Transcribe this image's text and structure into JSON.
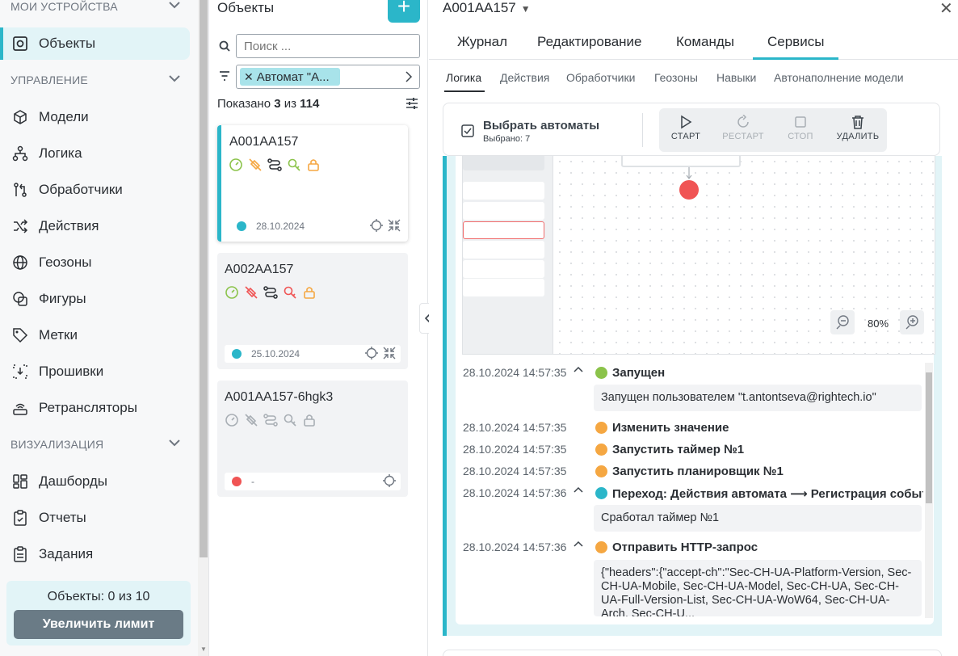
{
  "sidebar": {
    "sections": {
      "devices": "МОИ УСТРОЙСТВА",
      "management": "УПРАВЛЕНИЕ",
      "visualization": "ВИЗУАЛИЗАЦИЯ"
    },
    "items": [
      {
        "label": "Объекты",
        "icon": "objects-icon"
      },
      {
        "label": "Модели",
        "icon": "cube-icon"
      },
      {
        "label": "Логика",
        "icon": "logic-icon"
      },
      {
        "label": "Обработчики",
        "icon": "handlers-icon"
      },
      {
        "label": "Действия",
        "icon": "shuffle-icon"
      },
      {
        "label": "Геозоны",
        "icon": "globe-icon"
      },
      {
        "label": "Фигуры",
        "icon": "shapes-icon"
      },
      {
        "label": "Метки",
        "icon": "tag-icon"
      },
      {
        "label": "Прошивки",
        "icon": "firmware-icon"
      },
      {
        "label": "Ретрансляторы",
        "icon": "router-icon"
      },
      {
        "label": "Дашборды",
        "icon": "dashboard-icon"
      },
      {
        "label": "Отчеты",
        "icon": "report-icon"
      },
      {
        "label": "Задания",
        "icon": "tasks-icon"
      }
    ],
    "limit": {
      "text": "Объекты: 0 из 10",
      "button": "Увеличить лимит"
    }
  },
  "objects": {
    "title": "Объекты",
    "add_label": "+",
    "search_placeholder": "Поиск ...",
    "filter_chip": "Автомат \"A...",
    "shown_prefix": "Показано",
    "shown_count": "3",
    "shown_mid": "из",
    "shown_total": "114",
    "cards": [
      {
        "name": "A001AA157",
        "date": "28.10.2024",
        "status_color": "#2bb6c9"
      },
      {
        "name": "A002AA157",
        "date": "25.10.2024",
        "status_color": "#2bb6c9"
      },
      {
        "name": "A001AA157-6hgk3",
        "date": "-",
        "status_color": "#f05454"
      }
    ]
  },
  "detail": {
    "title": "A001AA157",
    "tabs": [
      "Журнал",
      "Редактирование",
      "Команды",
      "Сервисы"
    ],
    "active_tab": "Сервисы",
    "subtabs": [
      "Логика",
      "Действия",
      "Обработчики",
      "Геозоны",
      "Навыки",
      "Автонаполнение модели"
    ],
    "active_subtab": "Логика",
    "toolbar": {
      "select_label": "Выбрать автоматы",
      "selected_text": "Выбрано: 7",
      "start": "СТАРТ",
      "restart": "РЕСТАРТ",
      "stop": "СТОП",
      "delete": "УДАЛИТЬ"
    },
    "zoom": "80%",
    "log": [
      {
        "time": "28.10.2024 14:57:35",
        "event": "Запущен",
        "status": "green",
        "expandable": true,
        "message": "Запущен пользователем \"t.antontseva@rightech.io\""
      },
      {
        "time": "28.10.2024 14:57:35",
        "event": "Изменить значение",
        "status": "orange"
      },
      {
        "time": "28.10.2024 14:57:35",
        "event": "Запустить таймер №1",
        "status": "orange"
      },
      {
        "time": "28.10.2024 14:57:35",
        "event": "Запустить планировщик №1",
        "status": "orange"
      },
      {
        "time": "28.10.2024 14:57:36",
        "event": "Переход: Действия автомата ⟶ Регистрация событий",
        "status": "teal",
        "expandable": true,
        "message": "Сработал таймер №1"
      },
      {
        "time": "28.10.2024 14:57:36",
        "event": "Отправить HTTP-запрос",
        "status": "orange",
        "expandable": true,
        "message": "{\"headers\":{\"accept-ch\":\"Sec-CH-UA-Platform-Version, Sec-CH-UA-Mobile, Sec-CH-UA-Model, Sec-CH-UA, Sec-CH-UA-Full-Version-List, Sec-CH-UA-WoW64, Sec-CH-UA-Arch, Sec-CH-U..."
      }
    ]
  },
  "colors": {
    "accent": "#2bb6c9",
    "green": "#8bc34a",
    "orange": "#f5a742",
    "red": "#f05454"
  }
}
